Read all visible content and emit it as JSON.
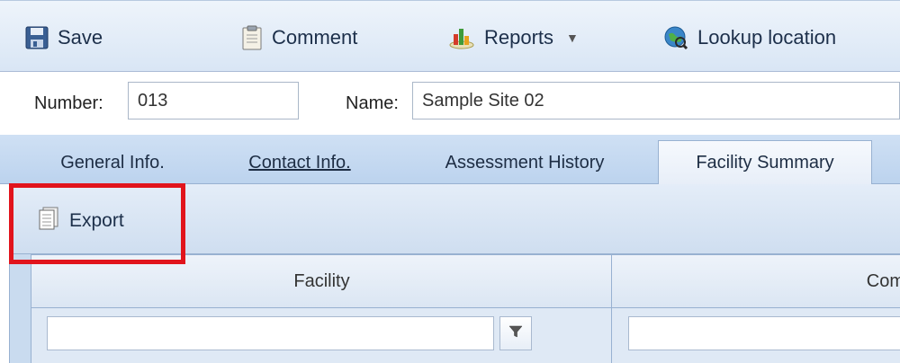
{
  "toolbar": {
    "save_label": "Save",
    "comment_label": "Comment",
    "reports_label": "Reports",
    "lookup_label": "Lookup location"
  },
  "fields": {
    "number_label": "Number:",
    "number_value": "013",
    "name_label": "Name:",
    "name_value": "Sample Site 02"
  },
  "tabs": [
    {
      "label": "General Info.",
      "active": false
    },
    {
      "label": "Contact Info.",
      "active": false
    },
    {
      "label": "Assessment History",
      "active": false
    },
    {
      "label": "Facility Summary",
      "active": true
    }
  ],
  "panel": {
    "export_label": "Export"
  },
  "grid": {
    "columns": [
      "Facility",
      "Com"
    ]
  },
  "colors": {
    "highlight": "#e1141c",
    "tab_bg": "#bcd3ee"
  }
}
